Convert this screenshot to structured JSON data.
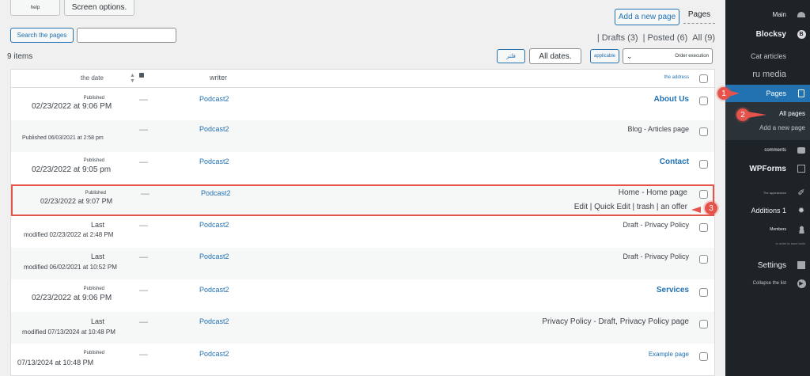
{
  "screen_meta": {
    "help_label": "help",
    "screen_options_label": "Screen options."
  },
  "header": {
    "add_new_page_label": "Add a new page",
    "pages_label": "Pages"
  },
  "search": {
    "button_label": "Search the pages",
    "placeholder": ""
  },
  "filters": {
    "drafts": "| Drafts (3)",
    "posted": "| Posted (6)",
    "all": "All (9)"
  },
  "bulk": {
    "items_count": "9 items",
    "filter_button": "فلتر",
    "date_select": "All dates.",
    "apply_button": "applicable",
    "order_select": "Order execution"
  },
  "table": {
    "headers": {
      "date": "the date",
      "writer": "writer",
      "address": "the address"
    },
    "rows": [
      {
        "status": "Published",
        "date": "02/23/2022 at 9:06 PM",
        "writer": "Podcast2",
        "title": "About Us",
        "style": "bold"
      },
      {
        "status": "",
        "date": "Published 06/03/2021 at 2:58 pm",
        "writer": "Podcast2",
        "title": "Blog - Articles page",
        "style": "plain"
      },
      {
        "status": "Published",
        "date": "02/23/2022 at 9:05 pm",
        "writer": "Podcast2",
        "title": "Contact",
        "style": "bold"
      },
      {
        "status": "Published",
        "date": "02/23/2022 at 9:07 PM",
        "writer": "Podcast2",
        "title": "Home - Home page",
        "style": "plain",
        "actions": "Edit | Quick Edit | trash | an offer"
      },
      {
        "status": "Last",
        "date": "modified 02/23/2022 at 2:48 PM",
        "writer": "Podcast2",
        "title": "Draft - Privacy Policy",
        "style": "plain"
      },
      {
        "status": "Last",
        "date": "modified 06/02/2021 at 10:52 PM",
        "writer": "Podcast2",
        "title": "Draft - Privacy Policy",
        "style": "plain"
      },
      {
        "status": "Published",
        "date": "02/23/2022 at 9:06 PM",
        "writer": "Podcast2",
        "title": "Services",
        "style": "bold"
      },
      {
        "status": "Last",
        "date": "modified 07/13/2024 at 10:48 PM",
        "writer": "Podcast2",
        "title": "Privacy Policy - Draft, Privacy Policy page",
        "style": "plain"
      },
      {
        "status": "Published",
        "date": "07/13/2024 at 10:48 PM",
        "writer": "Podcast2",
        "title": "Example page",
        "style": "link"
      }
    ]
  },
  "sidebar": {
    "main": "Main",
    "blocksy": "Blocksy",
    "cat_articles": "Cat articles",
    "ru_media": "ru media",
    "pages": "Pages",
    "all_pages": "All pages",
    "add_new_page": "Add a new page",
    "comments": "comments",
    "wpforms": "WPForms",
    "appearance": "The appearance",
    "additions": "Additions 1",
    "members": "Members",
    "small_note": "in order to have tools",
    "settings": "Settings",
    "collapse": "Collapse the list"
  },
  "callouts": {
    "one": "1",
    "two": "2",
    "three": "3"
  },
  "colors": {
    "accent": "#2271b1",
    "sidebar_bg": "#1d2327",
    "highlight": "#e5534b"
  }
}
